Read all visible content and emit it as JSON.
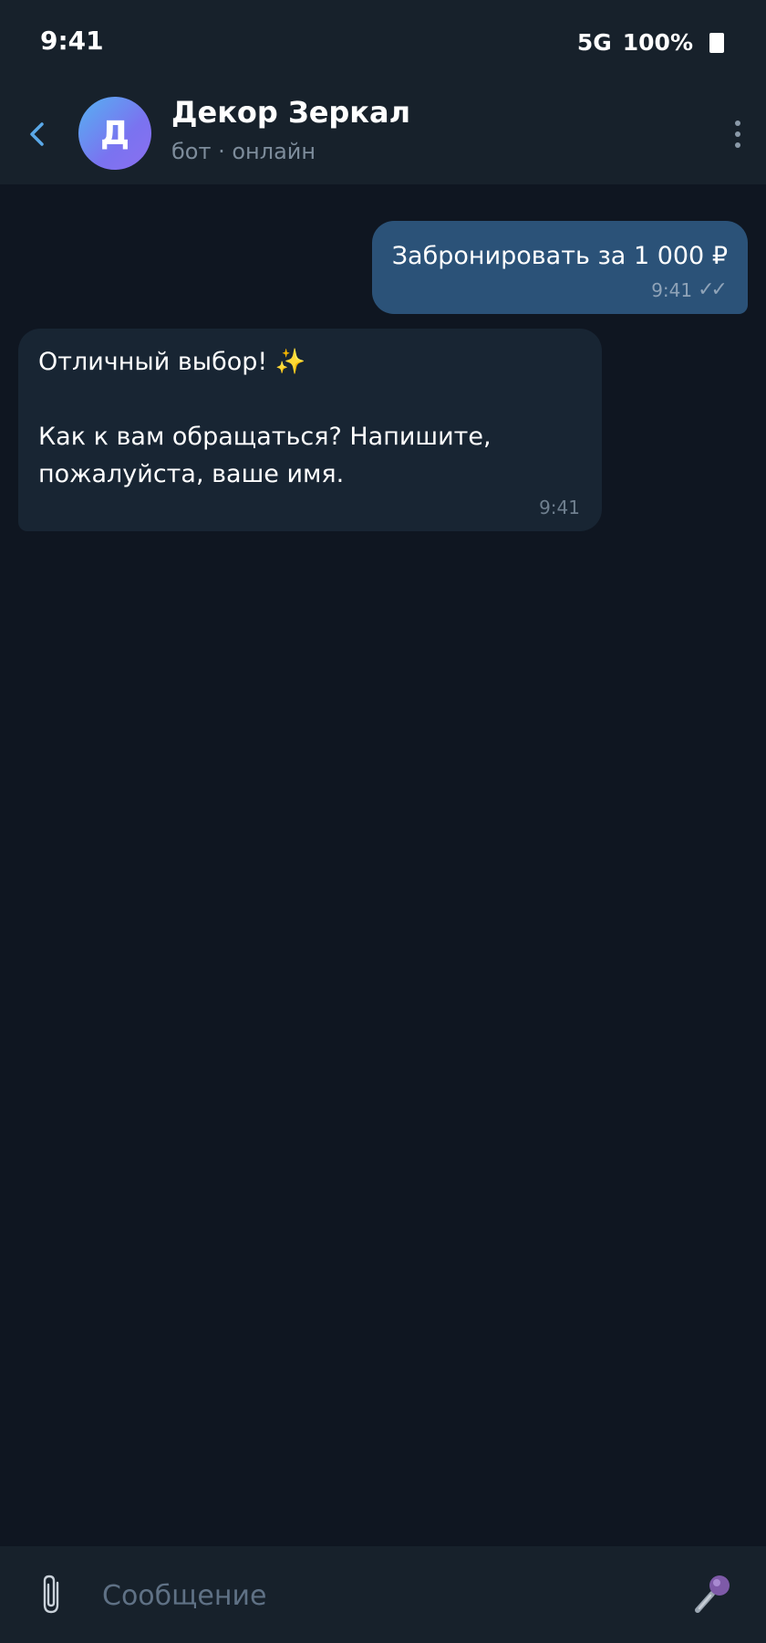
{
  "status_bar": {
    "time": "9:41",
    "network": "5G",
    "battery": "100%"
  },
  "header": {
    "avatar_letter": "Д",
    "title": "Декор Зеркал",
    "subtitle": "бот · онлайн",
    "back_icon": "chevron-left-icon",
    "menu_icon": "more-vertical-icon"
  },
  "messages": [
    {
      "direction": "outgoing",
      "text": "Забронировать за 1 000 ₽",
      "time": "9:41",
      "status": "✓✓"
    },
    {
      "direction": "incoming",
      "text": "Отличный выбор! ✨\n\nКак к вам обращаться? Напишите, пожалуйста, ваше имя.",
      "time": "9:41"
    }
  ],
  "composer": {
    "placeholder": "Сообщение",
    "attach_icon": "paperclip-icon",
    "mic_icon": "microphone-icon"
  },
  "colors": {
    "background": "#0f1621",
    "bar": "#17212b",
    "outgoing_bubble": "#2b5278",
    "incoming_bubble": "#182533",
    "accent": "#5aa8e8"
  }
}
